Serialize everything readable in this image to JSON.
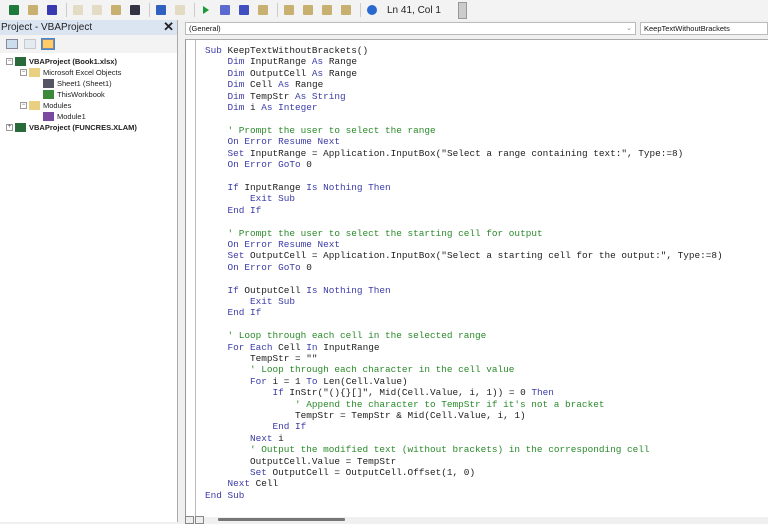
{
  "toolbar": {
    "status": "Ln 41, Col 1",
    "icons": [
      "excel-icon",
      "insert-userform-icon",
      "save-icon",
      "cut-icon",
      "copy-icon",
      "paste-icon",
      "find-icon",
      "undo-icon",
      "redo-icon",
      "run-icon",
      "break-icon",
      "reset-icon",
      "design-mode-icon",
      "project-explorer-icon",
      "properties-icon",
      "object-browser-icon",
      "toolbox-icon",
      "help-icon"
    ]
  },
  "project": {
    "title": "Project - VBAProject",
    "close": "✕",
    "tree": [
      {
        "label": "VBAProject (Book1.xlsx)",
        "level": 0,
        "exp": "−",
        "icon": "vbaproject-icon",
        "bold": true
      },
      {
        "label": "Microsoft Excel Objects",
        "level": 1,
        "exp": "−",
        "icon": "folder-icon"
      },
      {
        "label": "Sheet1 (Sheet1)",
        "level": 2,
        "icon": "sheet-icon"
      },
      {
        "label": "ThisWorkbook",
        "level": 2,
        "icon": "workbook-icon"
      },
      {
        "label": "Modules",
        "level": 1,
        "exp": "−",
        "icon": "folder-icon"
      },
      {
        "label": "Module1",
        "level": 2,
        "icon": "module-icon"
      },
      {
        "label": "VBAProject (FUNCRES.XLAM)",
        "level": 0,
        "exp": "+",
        "icon": "vbaproject-icon",
        "bold": true
      }
    ]
  },
  "editor": {
    "object_combo": "(General)",
    "proc_combo": "KeepTextWithoutBrackets",
    "code": [
      [
        [
          "k",
          "Sub "
        ],
        [
          "t",
          "KeepTextWithoutBrackets()"
        ]
      ],
      [
        [
          "t",
          "    "
        ],
        [
          "k",
          "Dim "
        ],
        [
          "t",
          "InputRange "
        ],
        [
          "k",
          "As "
        ],
        [
          "t",
          "Range"
        ]
      ],
      [
        [
          "t",
          "    "
        ],
        [
          "k",
          "Dim "
        ],
        [
          "t",
          "OutputCell "
        ],
        [
          "k",
          "As "
        ],
        [
          "t",
          "Range"
        ]
      ],
      [
        [
          "t",
          "    "
        ],
        [
          "k",
          "Dim "
        ],
        [
          "t",
          "Cell "
        ],
        [
          "k",
          "As "
        ],
        [
          "t",
          "Range"
        ]
      ],
      [
        [
          "t",
          "    "
        ],
        [
          "k",
          "Dim "
        ],
        [
          "t",
          "TempStr "
        ],
        [
          "k",
          "As String"
        ]
      ],
      [
        [
          "t",
          "    "
        ],
        [
          "k",
          "Dim "
        ],
        [
          "t",
          "i "
        ],
        [
          "k",
          "As Integer"
        ]
      ],
      [],
      [
        [
          "t",
          "    "
        ],
        [
          "c",
          "' Prompt the user to select the range"
        ]
      ],
      [
        [
          "t",
          "    "
        ],
        [
          "k",
          "On Error Resume Next"
        ]
      ],
      [
        [
          "t",
          "    "
        ],
        [
          "k",
          "Set "
        ],
        [
          "t",
          "InputRange = Application.InputBox(\"Select a range containing text:\", Type:=8)"
        ]
      ],
      [
        [
          "t",
          "    "
        ],
        [
          "k",
          "On Error GoTo "
        ],
        [
          "t",
          "0"
        ]
      ],
      [],
      [
        [
          "t",
          "    "
        ],
        [
          "k",
          "If "
        ],
        [
          "t",
          "InputRange "
        ],
        [
          "k",
          "Is Nothing Then"
        ]
      ],
      [
        [
          "t",
          "        "
        ],
        [
          "k",
          "Exit Sub"
        ]
      ],
      [
        [
          "t",
          "    "
        ],
        [
          "k",
          "End If"
        ]
      ],
      [],
      [
        [
          "t",
          "    "
        ],
        [
          "c",
          "' Prompt the user to select the starting cell for output"
        ]
      ],
      [
        [
          "t",
          "    "
        ],
        [
          "k",
          "On Error Resume Next"
        ]
      ],
      [
        [
          "t",
          "    "
        ],
        [
          "k",
          "Set "
        ],
        [
          "t",
          "OutputCell = Application.InputBox(\"Select a starting cell for the output:\", Type:=8)"
        ]
      ],
      [
        [
          "t",
          "    "
        ],
        [
          "k",
          "On Error GoTo "
        ],
        [
          "t",
          "0"
        ]
      ],
      [],
      [
        [
          "t",
          "    "
        ],
        [
          "k",
          "If "
        ],
        [
          "t",
          "OutputCell "
        ],
        [
          "k",
          "Is Nothing Then"
        ]
      ],
      [
        [
          "t",
          "        "
        ],
        [
          "k",
          "Exit Sub"
        ]
      ],
      [
        [
          "t",
          "    "
        ],
        [
          "k",
          "End If"
        ]
      ],
      [],
      [
        [
          "t",
          "    "
        ],
        [
          "c",
          "' Loop through each cell in the selected range"
        ]
      ],
      [
        [
          "t",
          "    "
        ],
        [
          "k",
          "For Each "
        ],
        [
          "t",
          "Cell "
        ],
        [
          "k",
          "In "
        ],
        [
          "t",
          "InputRange"
        ]
      ],
      [
        [
          "t",
          "        TempStr = \"\""
        ]
      ],
      [
        [
          "t",
          "        "
        ],
        [
          "c",
          "' Loop through each character in the cell value"
        ]
      ],
      [
        [
          "t",
          "        "
        ],
        [
          "k",
          "For "
        ],
        [
          "t",
          "i = 1 "
        ],
        [
          "k",
          "To "
        ],
        [
          "t",
          "Len(Cell.Value)"
        ]
      ],
      [
        [
          "t",
          "            "
        ],
        [
          "k",
          "If "
        ],
        [
          "t",
          "InStr(\"(){}[]\", Mid(Cell.Value, i, 1)) = 0 "
        ],
        [
          "k",
          "Then"
        ]
      ],
      [
        [
          "t",
          "                "
        ],
        [
          "c",
          "' Append the character to TempStr if it's not a bracket"
        ]
      ],
      [
        [
          "t",
          "                TempStr = TempStr & Mid(Cell.Value, i, 1)"
        ]
      ],
      [
        [
          "t",
          "            "
        ],
        [
          "k",
          "End If"
        ]
      ],
      [
        [
          "t",
          "        "
        ],
        [
          "k",
          "Next "
        ],
        [
          "t",
          "i"
        ]
      ],
      [
        [
          "t",
          "        "
        ],
        [
          "c",
          "' Output the modified text (without brackets) in the corresponding cell"
        ]
      ],
      [
        [
          "t",
          "        OutputCell.Value = TempStr"
        ]
      ],
      [
        [
          "t",
          "        "
        ],
        [
          "k",
          "Set "
        ],
        [
          "t",
          "OutputCell = OutputCell.Offset(1, 0)"
        ]
      ],
      [
        [
          "t",
          "    "
        ],
        [
          "k",
          "Next "
        ],
        [
          "t",
          "Cell"
        ]
      ],
      [
        [
          "k",
          "End Sub"
        ]
      ]
    ]
  }
}
